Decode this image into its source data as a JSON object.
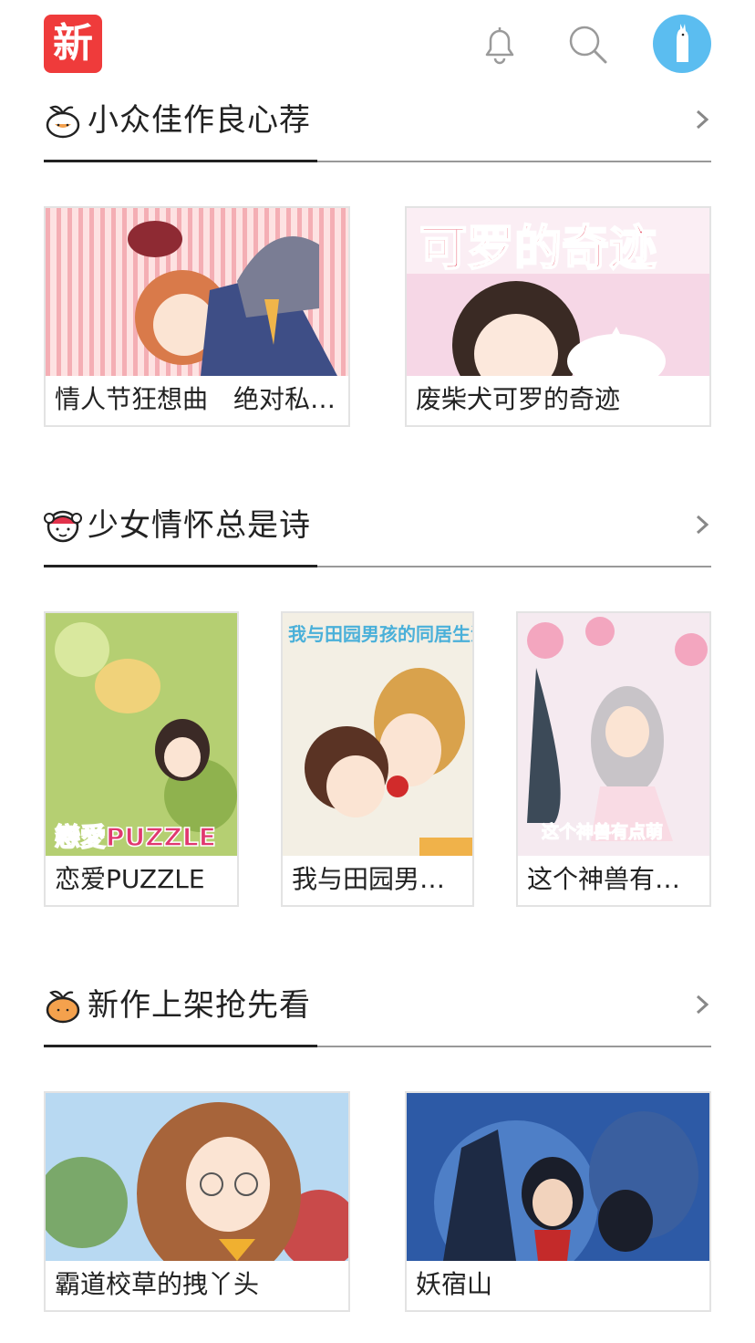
{
  "app": {
    "logo_text": "新",
    "icons": {
      "notifications": "bell-icon",
      "search": "search-icon",
      "avatar": "alpaca-avatar-icon"
    },
    "colors": {
      "logo": "#ef3b3b",
      "avatar_bg": "#5bbdf0"
    }
  },
  "sections": [
    {
      "title": "小众佳作良心荐",
      "icon": "orange-fruit-icon",
      "cards": [
        {
          "title": "情人节狂想曲　绝对私…",
          "thumb_bg": "#f3c5c8"
        },
        {
          "title": "废柴犬可罗的奇迹",
          "thumb_bg": "#f6d7e6",
          "thumb_caption": "可罗的奇迹"
        }
      ]
    },
    {
      "title": "少女情怀总是诗",
      "icon": "girl-face-icon",
      "cards": [
        {
          "title": "恋爱PUZZLE",
          "thumb_bg": "#b5cf72",
          "thumb_caption": "戀愛PUZZLE"
        },
        {
          "title": "我与田园男…",
          "thumb_bg": "#f3efe4",
          "thumb_caption": "我与田园男孩的同居生活"
        },
        {
          "title": "这个神兽有…",
          "thumb_bg": "#f5eaf0",
          "thumb_caption": "这个神兽有点萌"
        }
      ]
    },
    {
      "title": "新作上架抢先看",
      "icon": "orange-fruit-icon",
      "cards": [
        {
          "title": "霸道校草的拽丫头",
          "thumb_bg": "#b8d9f2"
        },
        {
          "title": "妖宿山",
          "thumb_bg": "#2d5aa6"
        }
      ]
    }
  ]
}
